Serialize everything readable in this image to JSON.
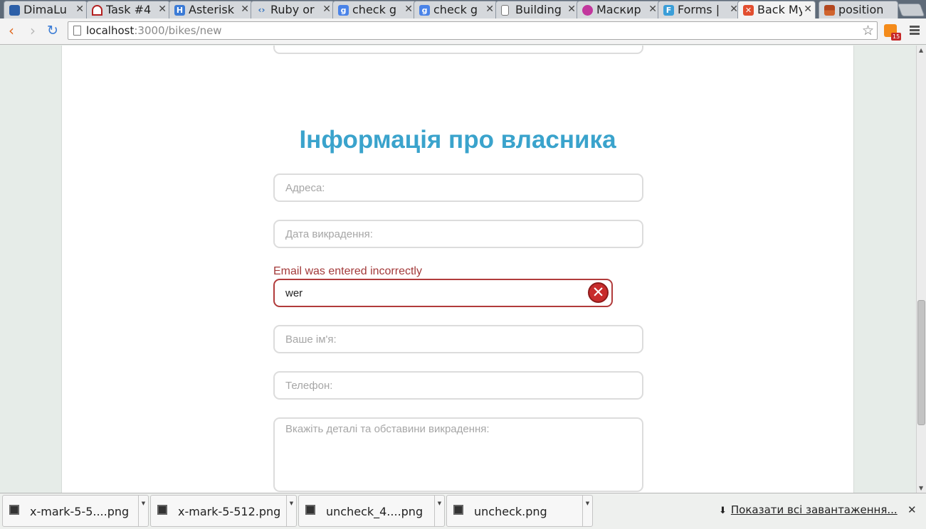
{
  "tabs": [
    {
      "label": "DimaLu",
      "icon": "shield-icon",
      "color": "#2c5fa8"
    },
    {
      "label": "Task #4",
      "icon": "redmine-icon",
      "color": "#b32020"
    },
    {
      "label": "Asterisk",
      "icon": "h-icon",
      "color": "#3c7bd6"
    },
    {
      "label": "Ruby or",
      "icon": "code-icon",
      "color": "#2e6fbf"
    },
    {
      "label": "check g",
      "icon": "google-icon",
      "color": "#4a83e8"
    },
    {
      "label": "check g",
      "icon": "google-icon",
      "color": "#4a83e8"
    },
    {
      "label": "Building",
      "icon": "page-icon",
      "color": "#ffffff"
    },
    {
      "label": "Маскир",
      "icon": "circle-icon",
      "color": "#c2379d"
    },
    {
      "label": "Forms |",
      "icon": "f-icon",
      "color": "#3a9ed8"
    },
    {
      "label": "Back My",
      "icon": "bike-icon",
      "color": "#e24e2f",
      "active": true
    },
    {
      "label": "position",
      "icon": "blocks-icon",
      "color": "#b3471f"
    }
  ],
  "toolbar": {
    "url_host": "localhost",
    "url_path": ":3000/bikes/new",
    "rss_badge": "15"
  },
  "form": {
    "section_title": "Інформація про власника",
    "address_placeholder": "Адреса:",
    "date_placeholder": "Дата викрадення:",
    "email_error": "Email was entered incorrectly",
    "email_value": "wer",
    "name_placeholder": "Ваше ім'я:",
    "phone_placeholder": "Телефон:",
    "details_placeholder": "Вкажіть деталі та обставини викрадення:"
  },
  "downloads": {
    "items": [
      {
        "name": "x-mark-5-5....png"
      },
      {
        "name": "x-mark-5-512.png"
      },
      {
        "name": "uncheck_4....png"
      },
      {
        "name": "uncheck.png"
      }
    ],
    "show_all": "Показати всі завантаження..."
  }
}
